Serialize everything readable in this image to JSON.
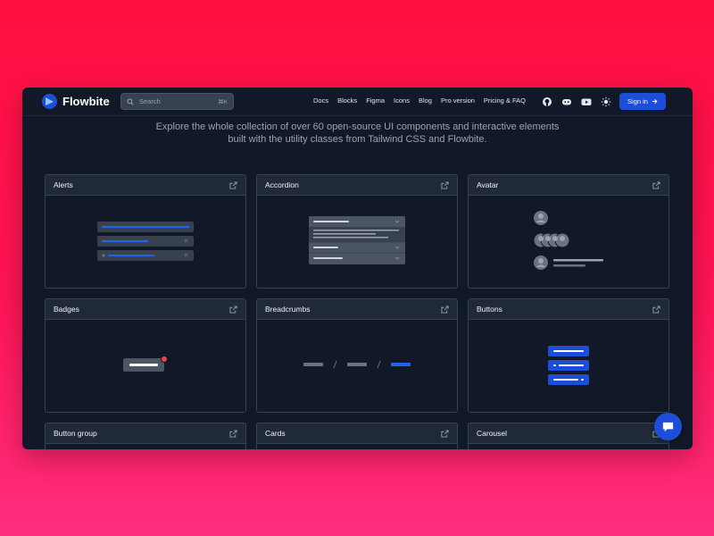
{
  "brand": {
    "name": "Flowbite"
  },
  "search": {
    "placeholder": "Search",
    "shortcut": "⌘K"
  },
  "nav": {
    "links": [
      "Docs",
      "Blocks",
      "Figma",
      "Icons",
      "Blog",
      "Pro version",
      "Pricing & FAQ"
    ],
    "icons": [
      "github-icon",
      "discord-icon",
      "youtube-icon",
      "sun-icon"
    ],
    "signin_label": "Sign in"
  },
  "intro": {
    "line1": "Explore the whole collection of over 60 open-source UI components and interactive elements",
    "line2": "built with the utility classes from Tailwind CSS and Flowbite."
  },
  "components": [
    {
      "title": "Alerts"
    },
    {
      "title": "Accordion"
    },
    {
      "title": "Avatar"
    },
    {
      "title": "Badges"
    },
    {
      "title": "Breadcrumbs"
    },
    {
      "title": "Buttons"
    },
    {
      "title": "Button group"
    },
    {
      "title": "Cards"
    },
    {
      "title": "Carousel"
    }
  ],
  "colors": {
    "background_top": "#ff0f3f",
    "background_bottom": "#ff2e7e",
    "window": "#111827",
    "accent": "#1d4ed8"
  }
}
